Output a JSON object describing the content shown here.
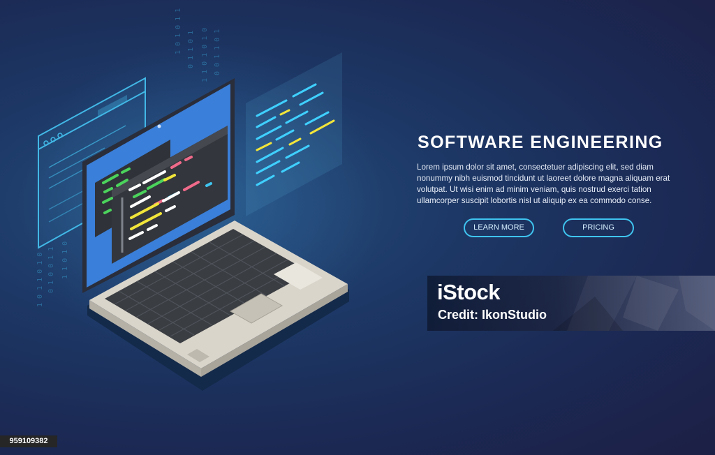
{
  "hero": {
    "title": "SOFTWARE ENGINEERING",
    "description": "Lorem ipsum dolor sit amet, consectetuer adipiscing elit, sed diam nonummy nibh euismod tincidunt ut laoreet dolore magna aliquam erat volutpat. Ut wisi enim ad minim veniam, quis nostrud exerci tation ullamcorper suscipit lobortis nisl ut aliquip ex ea commodo conse.",
    "learn_more_label": "LEARN MORE",
    "pricing_label": "PRICING"
  },
  "watermark": {
    "logo": "iStock",
    "credit": "Credit: IkonStudio"
  },
  "image_id": "959109382",
  "colors": {
    "background_dark": "#1c1f45",
    "background_light": "#264f7d",
    "accent_cyan": "#3fc4ef",
    "code_yellow": "#f2e53a",
    "code_green": "#4bd35c",
    "code_pink": "#f06a8a",
    "laptop_screen": "#3a7fd9"
  },
  "icons": [
    "laptop-icon",
    "code-window-icon",
    "code-panel-icon",
    "binary-rain-icon"
  ]
}
